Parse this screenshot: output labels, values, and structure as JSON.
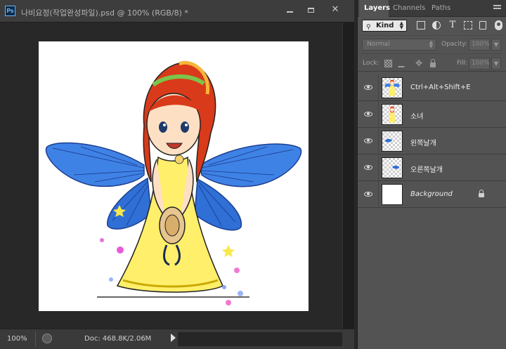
{
  "document": {
    "app_icon_label": "Ps",
    "title": "나비요정(작업완성파일).psd @ 100% (RGB/8) *",
    "zoom": "100%",
    "doc_info": "Doc: 468.8K/2.06M"
  },
  "panel": {
    "tabs": [
      "Layers",
      "Channels",
      "Paths"
    ],
    "filter_kind": "Kind",
    "blend_mode": "Normal",
    "opacity_label": "Opacity:",
    "opacity_value": "100%",
    "lock_label": "Lock:",
    "fill_label": "Fill:",
    "fill_value": "100%",
    "layers": [
      {
        "name": "Ctrl+Alt+Shift+E",
        "visible": true
      },
      {
        "name": "소녀",
        "visible": true
      },
      {
        "name": "왼쪽날개",
        "visible": true
      },
      {
        "name": "오른쪽날개",
        "visible": true
      },
      {
        "name": "Background",
        "visible": true,
        "locked": true
      }
    ]
  },
  "colors": {
    "wing_blue": "#2f6fd6",
    "dress_yellow": "#ffef6a",
    "hair_red": "#d93a1a",
    "panel_gray": "#535353",
    "doc_bg": "#282828"
  }
}
